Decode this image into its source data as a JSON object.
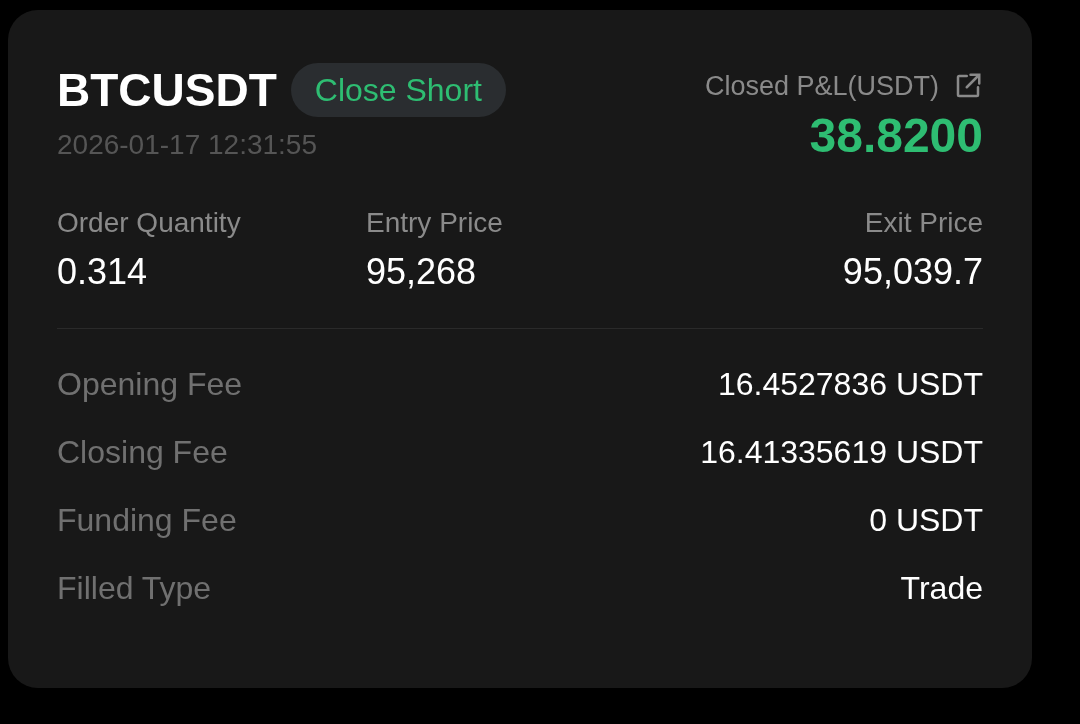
{
  "symbol": "BTCUSDT",
  "side_badge": "Close Short",
  "timestamp": "2026-01-17 12:31:55",
  "pnl": {
    "label": "Closed P&L(USDT)",
    "value": "38.8200"
  },
  "metrics": [
    {
      "label": "Order Quantity",
      "value": "0.314"
    },
    {
      "label": "Entry Price",
      "value": "95,268"
    },
    {
      "label": "Exit Price",
      "value": "95,039.7"
    }
  ],
  "details": [
    {
      "label": "Opening Fee",
      "value": "16.4527836 USDT"
    },
    {
      "label": "Closing Fee",
      "value": "16.41335619 USDT"
    },
    {
      "label": "Funding Fee",
      "value": "0 USDT"
    },
    {
      "label": "Filled Type",
      "value": "Trade"
    }
  ]
}
